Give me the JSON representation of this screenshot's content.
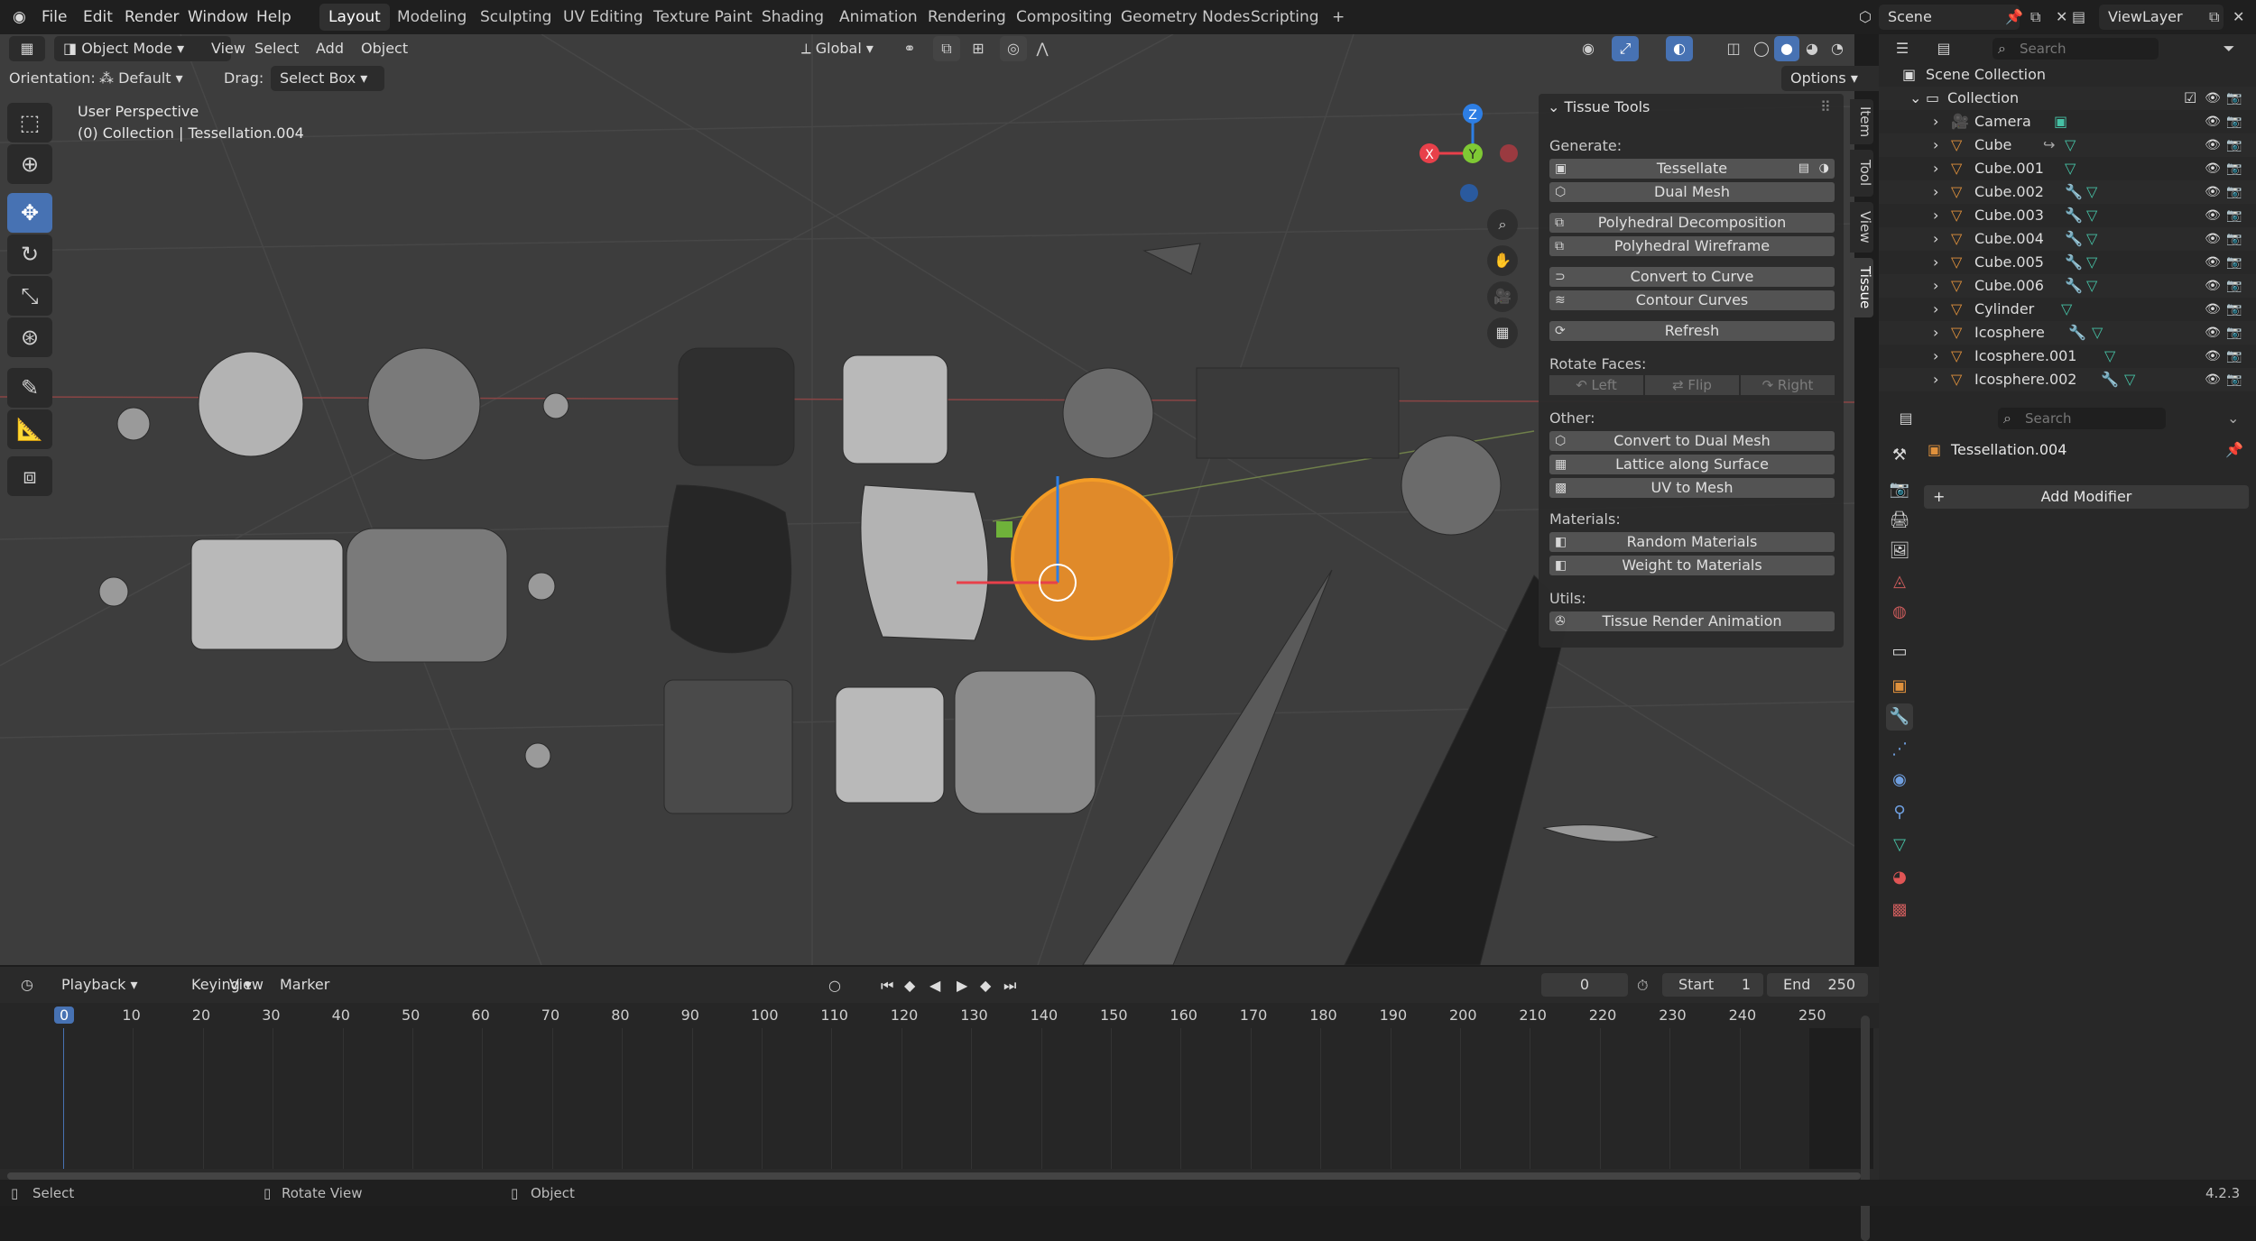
{
  "topbar": {
    "menus": [
      "File",
      "Edit",
      "Render",
      "Window",
      "Help"
    ],
    "workspaces": [
      "Layout",
      "Modeling",
      "Sculpting",
      "UV Editing",
      "Texture Paint",
      "Shading",
      "Animation",
      "Rendering",
      "Compositing",
      "Geometry Nodes",
      "Scripting"
    ],
    "active_workspace": "Layout",
    "add_tab": "+",
    "scene": "Scene",
    "view_layer": "ViewLayer"
  },
  "viewport_header": {
    "mode": "Object Mode",
    "menus": [
      "View",
      "Select",
      "Add",
      "Object"
    ],
    "transform_orientation": "Global",
    "orientation_label": "Orientation:",
    "orientation_value": "Default",
    "drag_label": "Drag:",
    "drag_value": "Select Box",
    "options": "Options"
  },
  "viewport": {
    "perspective": "User Perspective",
    "collection_info": "(0) Collection | Tessellation.004",
    "gizmo_axes": [
      "X",
      "Y",
      "Z"
    ]
  },
  "npanel": {
    "title": "Tissue Tools",
    "generate_label": "Generate:",
    "generate_buttons": [
      "Tessellate",
      "Dual Mesh",
      "Polyhedral Decomposition",
      "Polyhedral Wireframe",
      "Convert to Curve",
      "Contour Curves",
      "Refresh"
    ],
    "rotate_label": "Rotate Faces:",
    "rotate_buttons": [
      "Left",
      "Flip",
      "Right"
    ],
    "other_label": "Other:",
    "other_buttons": [
      "Convert to Dual Mesh",
      "Lattice along Surface",
      "UV to Mesh"
    ],
    "materials_label": "Materials:",
    "materials_buttons": [
      "Random Materials",
      "Weight to Materials"
    ],
    "utils_label": "Utils:",
    "utils_buttons": [
      "Tissue Render Animation"
    ],
    "side_tabs": [
      "Item",
      "Tool",
      "View",
      "Tissue"
    ],
    "active_side_tab": "Tissue"
  },
  "outliner": {
    "search_placeholder": "Search",
    "scene_collection": "Scene Collection",
    "collection": "Collection",
    "items": [
      "Camera",
      "Cube",
      "Cube.001",
      "Cube.002",
      "Cube.003",
      "Cube.004",
      "Cube.005",
      "Cube.006",
      "Cylinder",
      "Icosphere",
      "Icosphere.001",
      "Icosphere.002"
    ]
  },
  "properties": {
    "search_placeholder": "Search",
    "object_name": "Tessellation.004",
    "add_modifier": "Add Modifier"
  },
  "timeline": {
    "menus": [
      "Playback",
      "Keying",
      "View",
      "Marker"
    ],
    "current_frame": "0",
    "start_label": "Start",
    "start_value": "1",
    "end_label": "End",
    "end_value": "250",
    "ticks": [
      "0",
      "10",
      "20",
      "30",
      "40",
      "50",
      "60",
      "70",
      "80",
      "90",
      "100",
      "110",
      "120",
      "130",
      "140",
      "150",
      "160",
      "170",
      "180",
      "190",
      "200",
      "210",
      "220",
      "230",
      "240",
      "250"
    ]
  },
  "statusbar": {
    "select": "Select",
    "rotate_view": "Rotate View",
    "object": "Object",
    "version": "4.2.3"
  },
  "colors": {
    "accent": "#4772b3",
    "selected_outline": "#f39c26",
    "axis_x": "#e8404a",
    "axis_y": "#7fc934",
    "axis_z": "#2d7ee4"
  }
}
